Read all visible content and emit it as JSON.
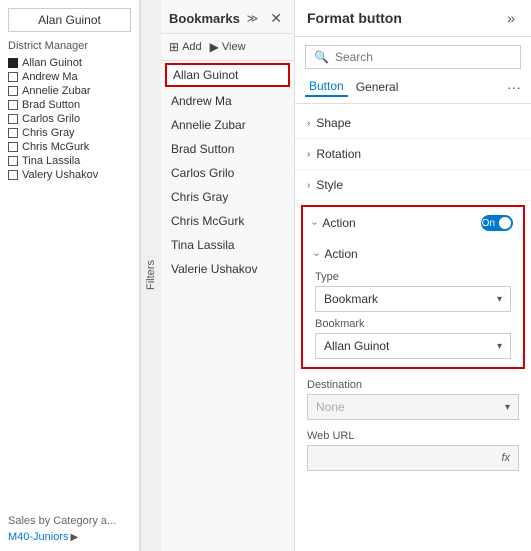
{
  "left": {
    "slicer_title": "Alan Guinot",
    "district_label": "District Manager",
    "district_items": [
      {
        "name": "Allan Guinot",
        "filled": true
      },
      {
        "name": "Andrew Ma",
        "filled": false
      },
      {
        "name": "Annelie Zubar",
        "filled": false
      },
      {
        "name": "Brad Sutton",
        "filled": false
      },
      {
        "name": "Carlos Grilo",
        "filled": false
      },
      {
        "name": "Chris Gray",
        "filled": false
      },
      {
        "name": "Chris McGurk",
        "filled": false
      },
      {
        "name": "Tina Lassila",
        "filled": false
      },
      {
        "name": "Valery Ushakov",
        "filled": false
      }
    ],
    "bottom_label1": "Sales by Category a...",
    "bottom_link": "M40-Juniors"
  },
  "bookmarks": {
    "title": "Bookmarks",
    "expand_icon": "≫",
    "close_icon": "✕",
    "add_label": "Add",
    "view_label": "View",
    "filters_tab": "Filters",
    "items": [
      {
        "name": "Allan Guinot",
        "active": true
      },
      {
        "name": "Andrew Ma",
        "active": false
      },
      {
        "name": "Annelie Zubar",
        "active": false
      },
      {
        "name": "Brad Sutton",
        "active": false
      },
      {
        "name": "Carlos Grilo",
        "active": false
      },
      {
        "name": "Chris Gray",
        "active": false
      },
      {
        "name": "Chris McGurk",
        "active": false
      },
      {
        "name": "Tina Lassila",
        "active": false
      },
      {
        "name": "Valerie Ushakov",
        "active": false
      }
    ]
  },
  "format": {
    "title": "Format button",
    "expand_icon": "»",
    "search_placeholder": "Search",
    "tabs": [
      "Button",
      "General"
    ],
    "more_icon": "···",
    "sections": [
      {
        "label": "Shape",
        "expanded": false
      },
      {
        "label": "Rotation",
        "expanded": false
      },
      {
        "label": "Style",
        "expanded": false
      }
    ],
    "action_section": {
      "label": "Action",
      "toggle_label": "On",
      "sub_label": "Action",
      "type_label": "Type",
      "type_value": "Bookmark",
      "bookmark_label": "Bookmark",
      "bookmark_value": "Allan Guinot",
      "destination_label": "Destination",
      "destination_value": "None",
      "weburl_label": "Web URL",
      "weburl_value": "",
      "fx_label": "fx"
    }
  }
}
